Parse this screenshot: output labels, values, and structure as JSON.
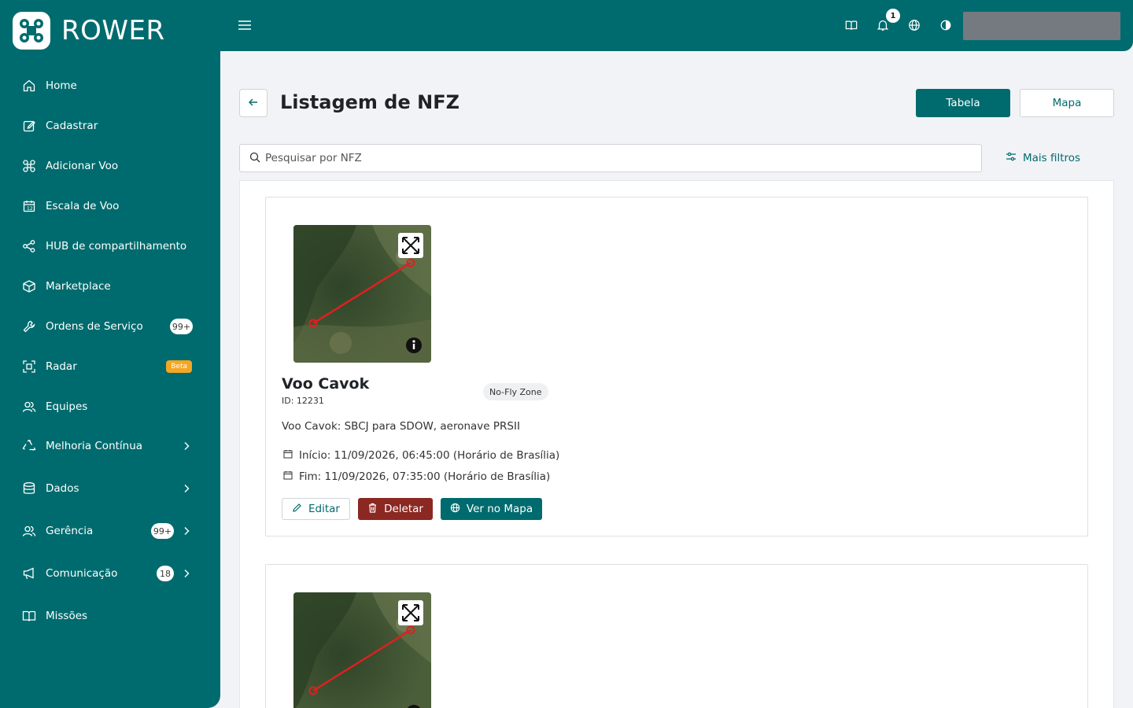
{
  "app": {
    "name": "ROWER"
  },
  "sidebar": {
    "items": [
      {
        "label": "Home",
        "icon": "home-icon"
      },
      {
        "label": "Cadastrar",
        "icon": "edit-square-icon"
      },
      {
        "label": "Adicionar Voo",
        "icon": "drone-icon"
      },
      {
        "label": "Escala de Voo",
        "icon": "calendar-icon"
      },
      {
        "label": "HUB de compartilhamento",
        "icon": "share-icon"
      },
      {
        "label": "Marketplace",
        "icon": "box-icon"
      },
      {
        "label": "Ordens de Serviço",
        "icon": "wrench-icon",
        "badge": "99+"
      },
      {
        "label": "Radar",
        "icon": "radar-icon",
        "beta": "Beta"
      },
      {
        "label": "Equipes",
        "icon": "users-icon"
      },
      {
        "label": "Melhoria Contínua",
        "icon": "recycle-icon"
      },
      {
        "label": "Dados",
        "icon": "database-icon"
      },
      {
        "label": "Gerência",
        "icon": "users-icon",
        "badge": "99+"
      },
      {
        "label": "Comunicação",
        "icon": "megaphone-icon",
        "badge": "18"
      },
      {
        "label": "Missões",
        "icon": "book-icon"
      }
    ]
  },
  "topbar": {
    "notification_count": "1"
  },
  "page": {
    "title": "Listagem de NFZ",
    "view_table_label": "Tabela",
    "view_map_label": "Mapa",
    "search_placeholder": "Pesquisar por NFZ",
    "more_filters_label": "Mais filtros"
  },
  "cards": [
    {
      "title": "Voo Cavok",
      "id": "ID: 12231",
      "tag": "No-Fly Zone",
      "description": "Voo Cavok: SBCJ para SDOW, aeronave PRSII",
      "start": "Início: 11/09/2026, 06:45:00 (Horário de Brasília)",
      "end": "Fim: 11/09/2026, 07:35:00 (Horário de Brasília)",
      "edit_label": "Editar",
      "delete_label": "Deletar",
      "view_map_label": "Ver no Mapa"
    }
  ],
  "colors": {
    "brand": "#006b6e",
    "danger": "#8b2822",
    "beta": "#f5a623",
    "route": "#e01f1f"
  }
}
